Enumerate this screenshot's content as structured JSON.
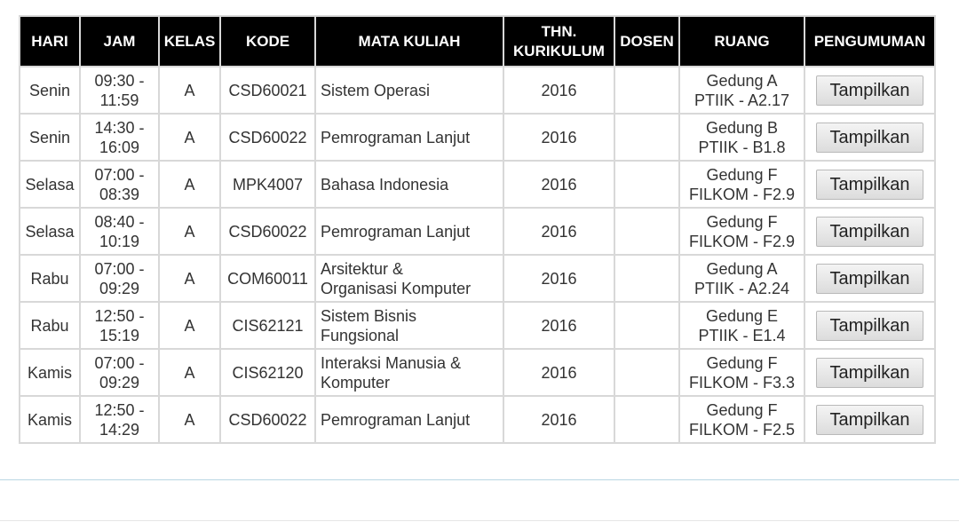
{
  "table": {
    "headers": {
      "hari": "HARI",
      "jam": "JAM",
      "kelas": "KELAS",
      "kode": "KODE",
      "mata_kuliah": "MATA KULIAH",
      "thn_kurikulum_line1": "THN.",
      "thn_kurikulum_line2": "KURIKULUM",
      "dosen": "DOSEN",
      "ruang": "RUANG",
      "pengumuman": "PENGUMUMAN"
    },
    "button_label": "Tampilkan",
    "rows": [
      {
        "hari": "Senin",
        "jam_start": "09:30 -",
        "jam_end": "11:59",
        "kelas": "A",
        "kode": "CSD60021",
        "mata_kuliah_line1": "Sistem Operasi",
        "mata_kuliah_line2": "",
        "thn": "2016",
        "dosen": "",
        "ruang_line1": "Gedung A",
        "ruang_line2": "PTIIK - A2.17"
      },
      {
        "hari": "Senin",
        "jam_start": "14:30 -",
        "jam_end": "16:09",
        "kelas": "A",
        "kode": "CSD60022",
        "mata_kuliah_line1": "Pemrograman Lanjut",
        "mata_kuliah_line2": "",
        "thn": "2016",
        "dosen": "",
        "ruang_line1": "Gedung B",
        "ruang_line2": "PTIIK - B1.8"
      },
      {
        "hari": "Selasa",
        "jam_start": "07:00 -",
        "jam_end": "08:39",
        "kelas": "A",
        "kode": "MPK4007",
        "mata_kuliah_line1": "Bahasa Indonesia",
        "mata_kuliah_line2": "",
        "thn": "2016",
        "dosen": "",
        "ruang_line1": "Gedung F",
        "ruang_line2": "FILKOM - F2.9"
      },
      {
        "hari": "Selasa",
        "jam_start": "08:40 -",
        "jam_end": "10:19",
        "kelas": "A",
        "kode": "CSD60022",
        "mata_kuliah_line1": "Pemrograman Lanjut",
        "mata_kuliah_line2": "",
        "thn": "2016",
        "dosen": "",
        "ruang_line1": "Gedung F",
        "ruang_line2": "FILKOM - F2.9"
      },
      {
        "hari": "Rabu",
        "jam_start": "07:00 -",
        "jam_end": "09:29",
        "kelas": "A",
        "kode": "COM60011",
        "mata_kuliah_line1": "Arsitektur &",
        "mata_kuliah_line2": "Organisasi Komputer",
        "thn": "2016",
        "dosen": "",
        "ruang_line1": "Gedung A",
        "ruang_line2": "PTIIK - A2.24"
      },
      {
        "hari": "Rabu",
        "jam_start": "12:50 -",
        "jam_end": "15:19",
        "kelas": "A",
        "kode": "CIS62121",
        "mata_kuliah_line1": "Sistem Bisnis",
        "mata_kuliah_line2": "Fungsional",
        "thn": "2016",
        "dosen": "",
        "ruang_line1": "Gedung E",
        "ruang_line2": "PTIIK - E1.4"
      },
      {
        "hari": "Kamis",
        "jam_start": "07:00 -",
        "jam_end": "09:29",
        "kelas": "A",
        "kode": "CIS62120",
        "mata_kuliah_line1": "Interaksi Manusia &",
        "mata_kuliah_line2": "Komputer",
        "thn": "2016",
        "dosen": "",
        "ruang_line1": "Gedung F",
        "ruang_line2": "FILKOM - F3.3"
      },
      {
        "hari": "Kamis",
        "jam_start": "12:50 -",
        "jam_end": "14:29",
        "kelas": "A",
        "kode": "CSD60022",
        "mata_kuliah_line1": "Pemrograman Lanjut",
        "mata_kuliah_line2": "",
        "thn": "2016",
        "dosen": "",
        "ruang_line1": "Gedung F",
        "ruang_line2": "FILKOM - F2.5"
      }
    ]
  }
}
